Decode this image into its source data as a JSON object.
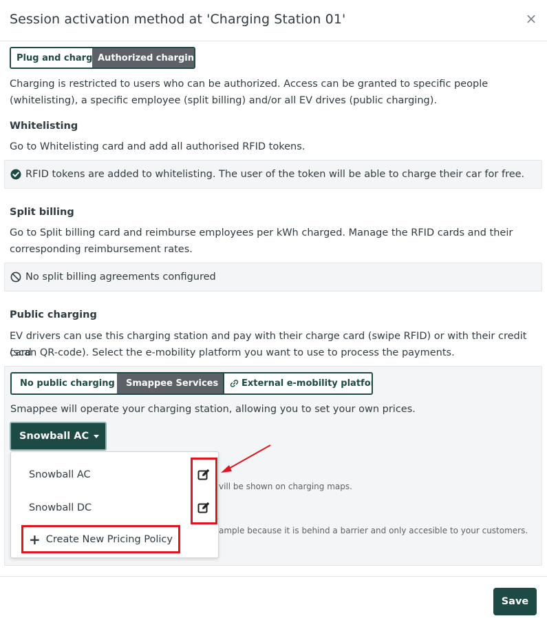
{
  "modal": {
    "title": "Session activation method at 'Charging Station 01'",
    "close_label": "×"
  },
  "mode_toggle": {
    "options": [
      "Plug and charge",
      "Authorized charging"
    ],
    "selected": "Authorized charging"
  },
  "intro": {
    "line1": "Charging is restricted to users who can be authorized. Access can be granted to specific people",
    "line2": "(whitelisting), a specific employee (split billing) and/or all EV drives (public charging)."
  },
  "whitelisting": {
    "heading": "Whitelisting",
    "description": "Go to Whitelisting card and add all authorised RFID tokens.",
    "status": "RFID tokens are added to whitelisting. The user of the token will be able to charge their car for free.",
    "status_icon": "check-circle-icon"
  },
  "split_billing": {
    "heading": "Split billing",
    "line1": "Go to Split billing card and reimburse employees per kWh charged. Manage the RFID cards and their",
    "line2": "corresponding reimbursement rates.",
    "status": "No split billing agreements configured",
    "status_icon": "ban-icon"
  },
  "public_charging": {
    "heading": "Public charging",
    "line1": "EV drivers can use this charging station and pay with their charge card (swipe RFID) or with their credit card",
    "line2": "(scan QR-code). Select the e-mobility platform you want to use to process the payments.",
    "options": [
      "No public charging",
      "Smappee Services",
      "External e-mobility platform"
    ],
    "selected": "Smappee Services",
    "description": "Smappee will operate your charging station, allowing you to set your own prices.",
    "partial_text1": "vill be shown on charging maps.",
    "partial_text2": "ample because it is behind a barrier and only accesible to your customers."
  },
  "pricing_dropdown": {
    "selected": "Snowball AC",
    "items": [
      "Snowball AC",
      "Snowball DC"
    ],
    "create_label": "Create New Pricing Policy"
  },
  "footer": {
    "save_label": "Save"
  },
  "colors": {
    "primary": "#1d4a44",
    "active_toggle": "#5b6166",
    "annotation": "#e0151d",
    "panel_bg": "#f4f5f6"
  }
}
